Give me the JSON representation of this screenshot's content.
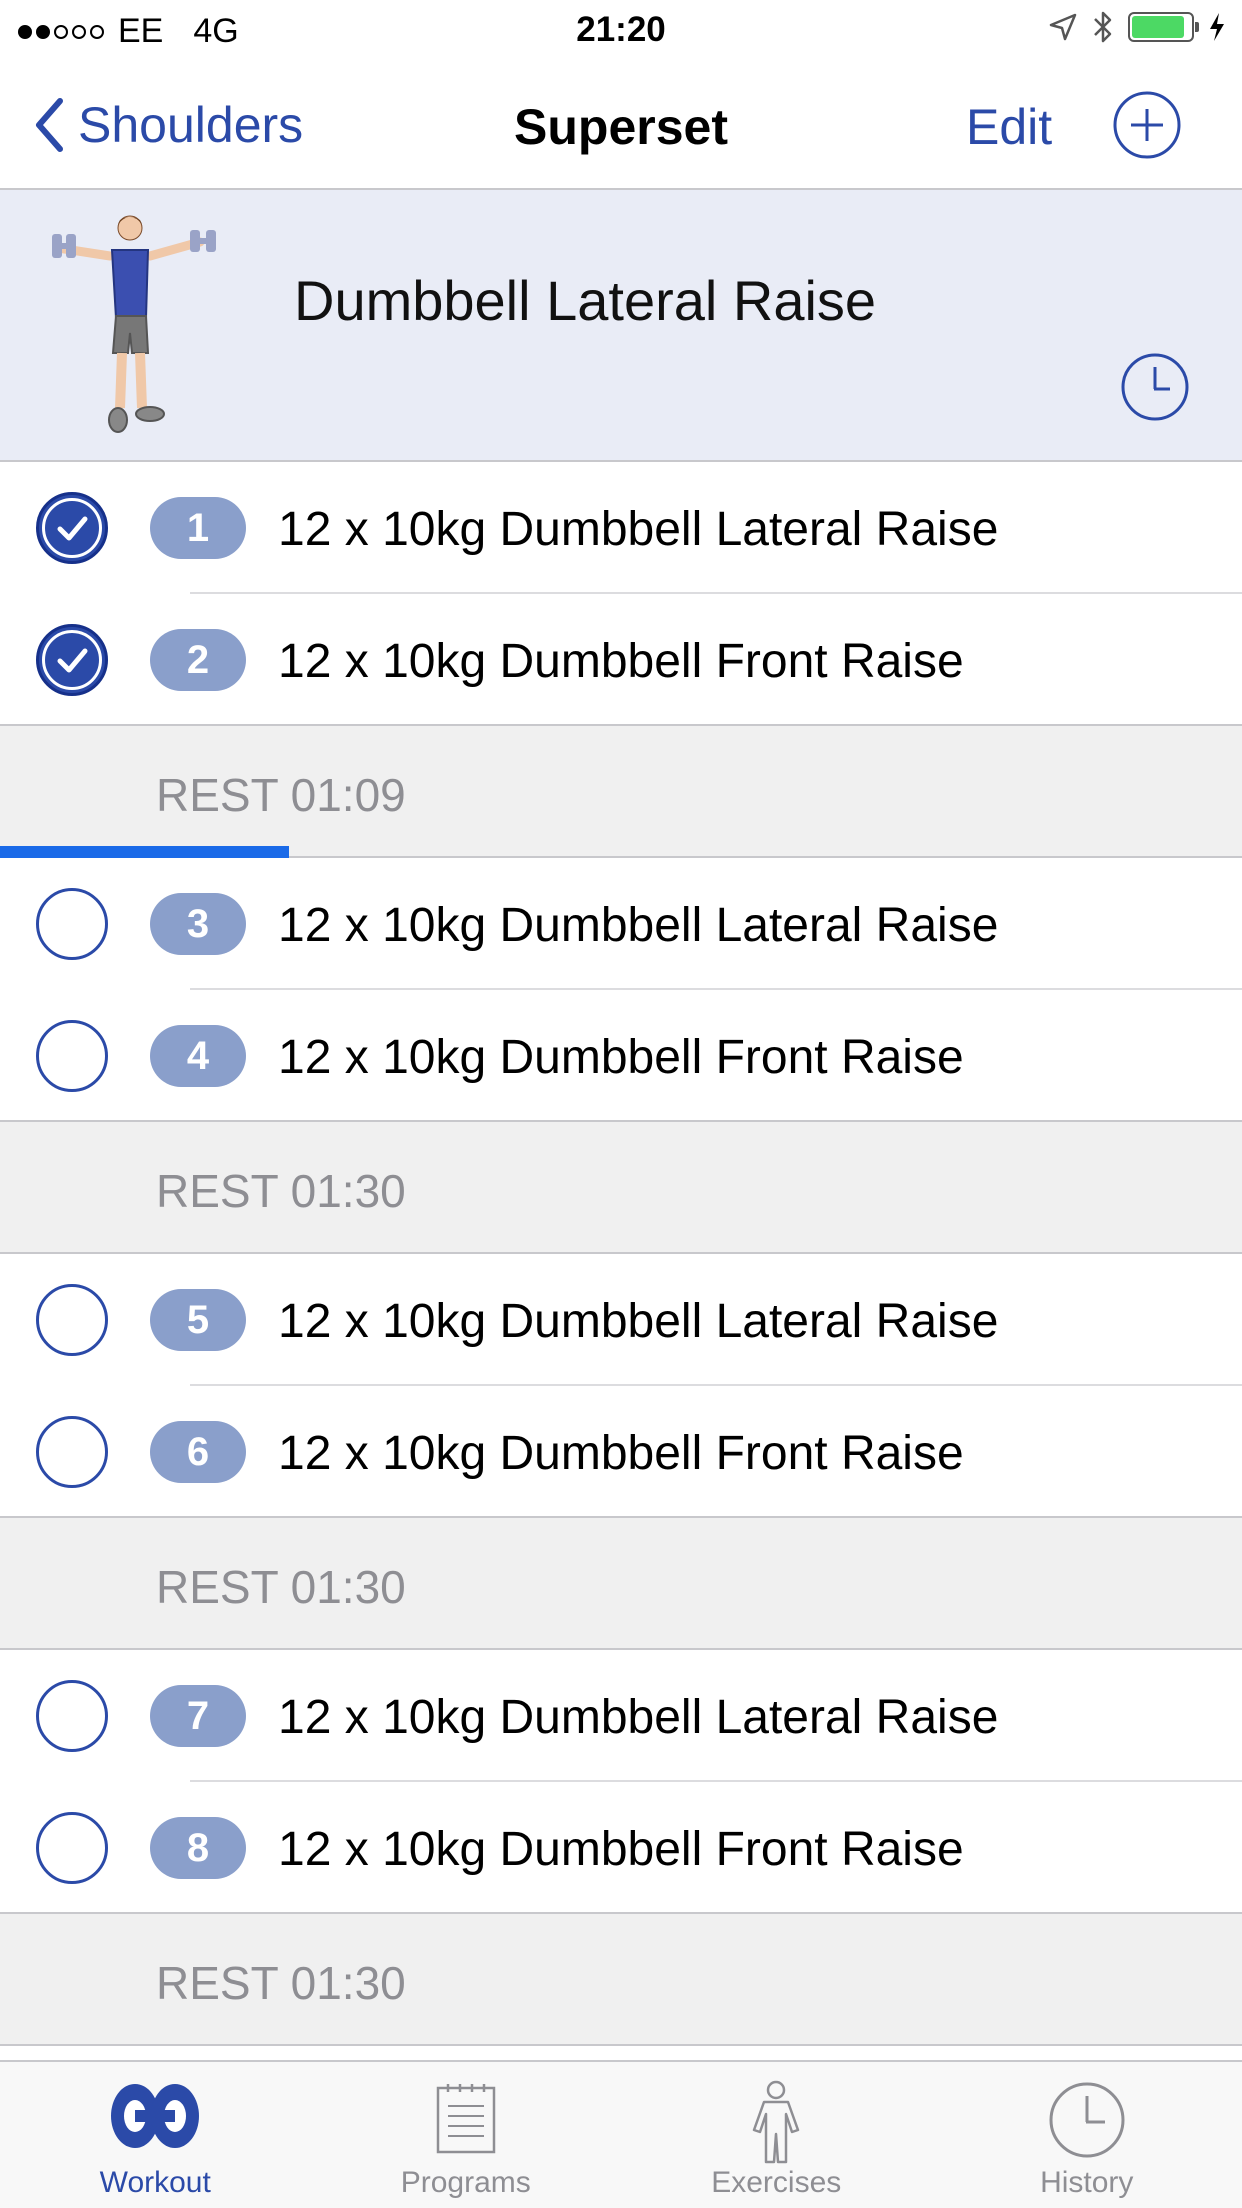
{
  "status_bar": {
    "carrier": "EE",
    "network": "4G",
    "time": "21:20",
    "signal_bars_filled": 2,
    "signal_bars_total": 5,
    "battery_level": 0.9,
    "battery_color": "#4cd964"
  },
  "nav": {
    "back_label": "Shoulders",
    "title": "Superset",
    "edit_label": "Edit",
    "add_icon": "plus-circle-icon"
  },
  "exercise": {
    "title": "Dumbbell Lateral Raise",
    "timer_icon": "clock-icon"
  },
  "rows": [
    {
      "type": "set",
      "number": "1",
      "text": "12 x 10kg Dumbbell Lateral Raise",
      "done": true
    },
    {
      "type": "set",
      "number": "2",
      "text": "12 x 10kg Dumbbell Front Raise",
      "done": true
    },
    {
      "type": "rest",
      "text": "REST 01:09",
      "progress": 0.233
    },
    {
      "type": "set",
      "number": "3",
      "text": "12 x 10kg Dumbbell Lateral Raise",
      "done": false
    },
    {
      "type": "set",
      "number": "4",
      "text": "12 x 10kg Dumbbell Front Raise",
      "done": false
    },
    {
      "type": "rest",
      "text": "REST 01:30"
    },
    {
      "type": "set",
      "number": "5",
      "text": "12 x 10kg Dumbbell Lateral Raise",
      "done": false
    },
    {
      "type": "set",
      "number": "6",
      "text": "12 x 10kg Dumbbell Front Raise",
      "done": false
    },
    {
      "type": "rest",
      "text": "REST 01:30"
    },
    {
      "type": "set",
      "number": "7",
      "text": "12 x 10kg Dumbbell Lateral Raise",
      "done": false
    },
    {
      "type": "set",
      "number": "8",
      "text": "12 x 10kg Dumbbell Front Raise",
      "done": false
    },
    {
      "type": "rest",
      "text": "REST 01:30"
    }
  ],
  "tabs": [
    {
      "label": "Workout",
      "icon": "workout-icon",
      "active": true
    },
    {
      "label": "Programs",
      "icon": "programs-icon",
      "active": false
    },
    {
      "label": "Exercises",
      "icon": "exercises-icon",
      "active": false
    },
    {
      "label": "History",
      "icon": "history-icon",
      "active": false
    }
  ],
  "colors": {
    "accent": "#2b4aa8",
    "header_bg": "#e9ecf6",
    "pill": "#8a9fcb",
    "rest_bg": "#f0f0f0",
    "progress": "#1a6ae8"
  }
}
